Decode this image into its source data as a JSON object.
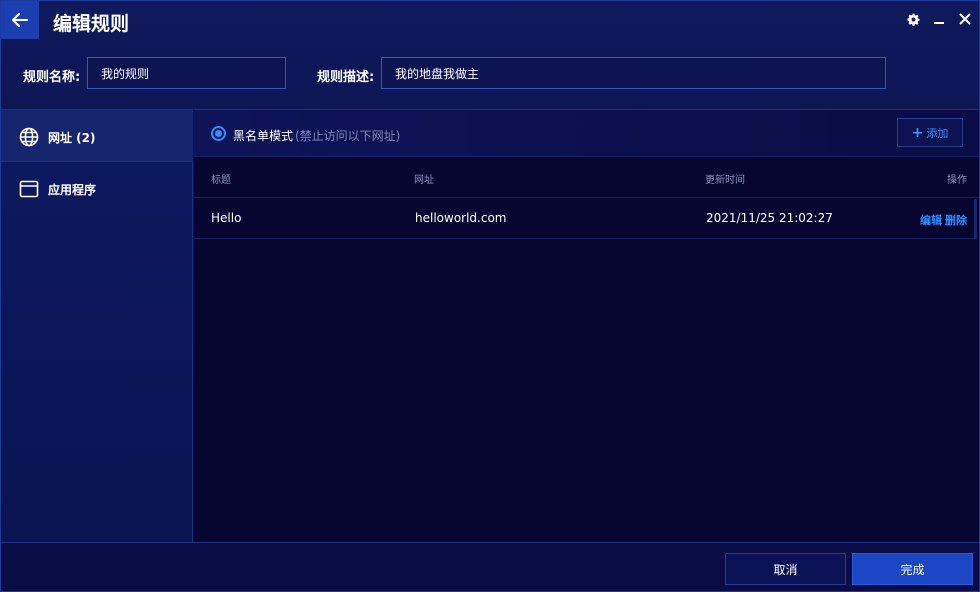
{
  "window": {
    "title": "编辑规则",
    "colors": {
      "accent": "#2f8cff",
      "back_button": "#1b3fb0",
      "primary_button": "#1b46c4"
    }
  },
  "fields": {
    "name_label": "规则名称:",
    "name_value": "我的规则",
    "desc_label": "规则描述:",
    "desc_value": "我的地盘我做主"
  },
  "sidebar": {
    "items": [
      {
        "label": "网址 (2)",
        "icon": "globe-icon",
        "active": true
      },
      {
        "label": "应用程序",
        "icon": "app-window-icon",
        "active": false
      }
    ]
  },
  "main": {
    "mode_label": "黑名单模式",
    "mode_note": "(禁止访问以下网址)",
    "add_label": "添加",
    "columns": [
      "标题",
      "网址",
      "更新时间",
      "操作"
    ],
    "rows": [
      {
        "title": "Hello",
        "url": "helloworld.com",
        "updated": "2021/11/25 21:02:27",
        "edit": "编辑",
        "delete": "删除"
      }
    ]
  },
  "footer": {
    "cancel_label": "取消",
    "done_label": "完成"
  }
}
